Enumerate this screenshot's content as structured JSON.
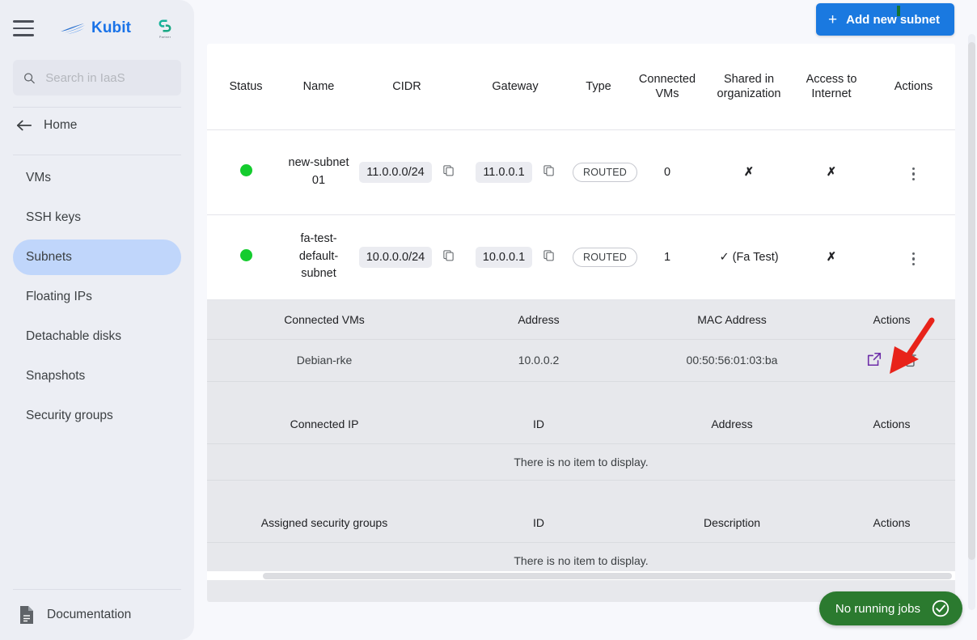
{
  "sidebar": {
    "menu_icon": "hamburger-icon",
    "brand": {
      "name": "Kubit",
      "logo_icon": "kubit-wave-logo"
    },
    "partner_logo": {
      "mark": "S",
      "caption": "Partner"
    },
    "search": {
      "value": "",
      "placeholder": "Search in IaaS",
      "icon": "search-icon"
    },
    "home": {
      "label": "Home",
      "icon": "back-arrow-icon"
    },
    "items": [
      {
        "label": "VMs",
        "active": false
      },
      {
        "label": "SSH keys",
        "active": false
      },
      {
        "label": "Subnets",
        "active": true
      },
      {
        "label": "Floating IPs",
        "active": false
      },
      {
        "label": "Detachable disks",
        "active": false
      },
      {
        "label": "Snapshots",
        "active": false
      },
      {
        "label": "Security groups",
        "active": false
      }
    ],
    "documentation": {
      "label": "Documentation",
      "icon": "document-icon"
    }
  },
  "toolbar": {
    "add_subnet_label": "Add new subnet",
    "add_icon": "plus-icon"
  },
  "table": {
    "headers": [
      "Status",
      "Name",
      "CIDR",
      "Gateway",
      "Type",
      "Connected VMs",
      "Shared in organization",
      "Access to Internet",
      "Actions"
    ],
    "rows": [
      {
        "status": "running",
        "name": "new-subnet 01",
        "cidr": "11.0.0.0/24",
        "gateway": "11.0.0.1",
        "type": "ROUTED",
        "connected_vms": "0",
        "shared_in_org": "✗",
        "access_to_internet": "✗"
      },
      {
        "status": "running",
        "name": "fa-test-default-subnet",
        "cidr": "10.0.0.0/24",
        "gateway": "10.0.0.1",
        "type": "ROUTED",
        "connected_vms": "1",
        "shared_in_org": "✓ (Fa Test)",
        "access_to_internet": "✗"
      }
    ]
  },
  "detail": {
    "connected_vms": {
      "headers": [
        "Connected VMs",
        "Address",
        "MAC Address",
        "Actions"
      ],
      "rows": [
        {
          "name": "Debian-rke",
          "address": "10.0.0.2",
          "mac": "00:50:56:01:03:ba"
        }
      ]
    },
    "connected_ip": {
      "headers": [
        "Connected IP",
        "ID",
        "Address",
        "Actions"
      ],
      "empty_text": "There is no item to display."
    },
    "assigned_security_groups": {
      "headers": [
        "Assigned security groups",
        "ID",
        "Description",
        "Actions"
      ],
      "empty_text": "There is no item to display."
    }
  },
  "status_bar": {
    "jobs_label": "No running jobs",
    "jobs_icon": "check-circle-icon"
  },
  "colors": {
    "accent_blue": "#1a79e0",
    "brand_blue": "#1a73e8",
    "active_nav": "#c0d6fb",
    "status_green": "#14cc2e",
    "jobs_green": "#2b7a2f",
    "link_purple": "#6d2da8",
    "annotation_red": "#e8231a"
  }
}
